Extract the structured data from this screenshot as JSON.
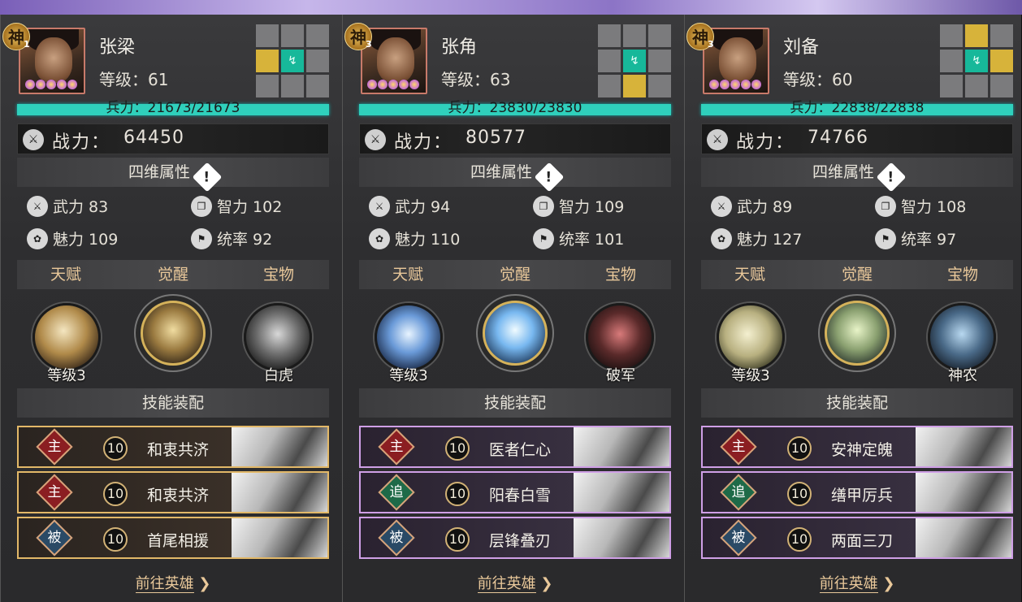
{
  "labels": {
    "troops_prefix": "兵力：",
    "power_label": "战力：",
    "attributes_title": "四维属性",
    "tab_talent": "天赋",
    "tab_awaken": "觉醒",
    "tab_treasure": "宝物",
    "skills_title": "技能装配",
    "goto_hero": "前往英雄",
    "warn_icon": "!",
    "shen_mark": "神"
  },
  "colors": {
    "troop_bar": "#2fd0bc",
    "grid_gold": "#d7b33a",
    "grid_green": "#17b89a",
    "tab_text": "#e9c89a"
  },
  "heroes": [
    {
      "name": "张梁",
      "level": "等级：61",
      "shen_rank": "1",
      "troops": "兵力：21673/21673",
      "power": "64450",
      "stats": {
        "force": "武力 83",
        "intellect": "智力 102",
        "charm": "魅力 109",
        "command": "统率 92"
      },
      "grid": [
        "n",
        "n",
        "n",
        "y",
        "g",
        "n",
        "n",
        "n",
        "n"
      ],
      "talent_caption": "等级3",
      "treasure_caption": "白虎",
      "skills": [
        {
          "type": "主",
          "level": "10",
          "name": "和衷共济"
        },
        {
          "type": "主",
          "level": "10",
          "name": "和衷共济"
        },
        {
          "type": "被",
          "level": "10",
          "name": "首尾相援"
        }
      ]
    },
    {
      "name": "张角",
      "level": "等级：63",
      "shen_rank": "3",
      "troops": "兵力：23830/23830",
      "power": "80577",
      "stats": {
        "force": "武力 94",
        "intellect": "智力 109",
        "charm": "魅力 110",
        "command": "统率 101"
      },
      "grid": [
        "n",
        "n",
        "n",
        "n",
        "g",
        "n",
        "n",
        "y",
        "n"
      ],
      "talent_caption": "等级3",
      "treasure_caption": "破军",
      "skills": [
        {
          "type": "主",
          "level": "10",
          "name": "医者仁心"
        },
        {
          "type": "追",
          "level": "10",
          "name": "阳春白雪"
        },
        {
          "type": "被",
          "level": "10",
          "name": "层锋叠刃"
        }
      ]
    },
    {
      "name": "刘备",
      "level": "等级：60",
      "shen_rank": "3",
      "troops": "兵力：22838/22838",
      "power": "74766",
      "stats": {
        "force": "武力 89",
        "intellect": "智力 108",
        "charm": "魅力 127",
        "command": "统率 97"
      },
      "grid": [
        "n",
        "y",
        "n",
        "n",
        "g",
        "y",
        "n",
        "n",
        "n"
      ],
      "talent_caption": "等级3",
      "treasure_caption": "神农",
      "skills": [
        {
          "type": "主",
          "level": "10",
          "name": "安神定魄"
        },
        {
          "type": "追",
          "level": "10",
          "name": "缮甲厉兵"
        },
        {
          "type": "被",
          "level": "10",
          "name": "两面三刀"
        }
      ]
    }
  ]
}
